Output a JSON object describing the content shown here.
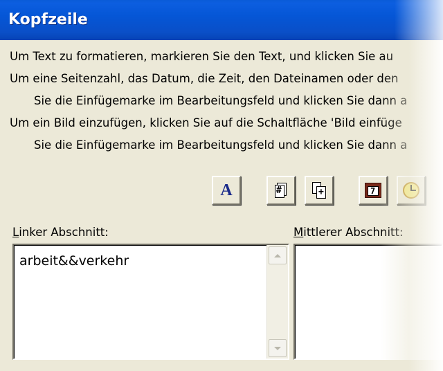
{
  "window": {
    "title": "Kopfzeile"
  },
  "instructions": [
    "Um Text zu formatieren, markieren Sie den Text, und klicken Sie au",
    "Um eine Seitenzahl, das Datum, die Zeit, den Dateinamen oder den",
    "Sie die Einfügemarke im Bearbeitungsfeld und klicken Sie dann a",
    "Um ein Bild einzufügen, klicken Sie auf die Schaltfläche 'Bild einfüge",
    "Sie die Einfügemarke im Bearbeitungsfeld und klicken Sie dann a"
  ],
  "toolbar": {
    "buttons": [
      {
        "icon": "font-icon",
        "glyph": "A"
      },
      {
        "icon": "page-number-icon",
        "glyph": "#"
      },
      {
        "icon": "total-pages-icon",
        "glyph": "+"
      },
      {
        "icon": "date-icon",
        "glyph": "7"
      },
      {
        "icon": "time-icon",
        "glyph": ""
      }
    ]
  },
  "sections": {
    "left": {
      "label_accel": "L",
      "label_rest": "inker Abschnitt:",
      "value": "arbeit&&verkehr"
    },
    "center": {
      "label_accel": "M",
      "label_rest": "ittlerer Abschnitt:",
      "value": ""
    }
  },
  "colors": {
    "titlebar": "#0556d6",
    "dialog_bg": "#ece9d8",
    "font_button_letter": "#1a2a8a"
  }
}
